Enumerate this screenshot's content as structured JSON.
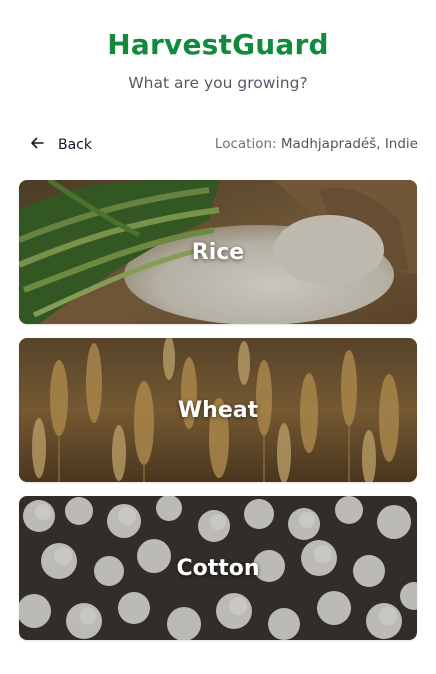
{
  "header": {
    "title": "HarvestGuard",
    "subtitle": "What are you growing?"
  },
  "nav": {
    "back_label": "Back",
    "location_label": "Location: ",
    "location_value": "Madhjapradéš, Indie"
  },
  "crops": [
    {
      "label": "Rice"
    },
    {
      "label": "Wheat"
    },
    {
      "label": "Cotton"
    }
  ],
  "colors": {
    "brand": "#118a3c",
    "subtitle": "#545b66"
  }
}
